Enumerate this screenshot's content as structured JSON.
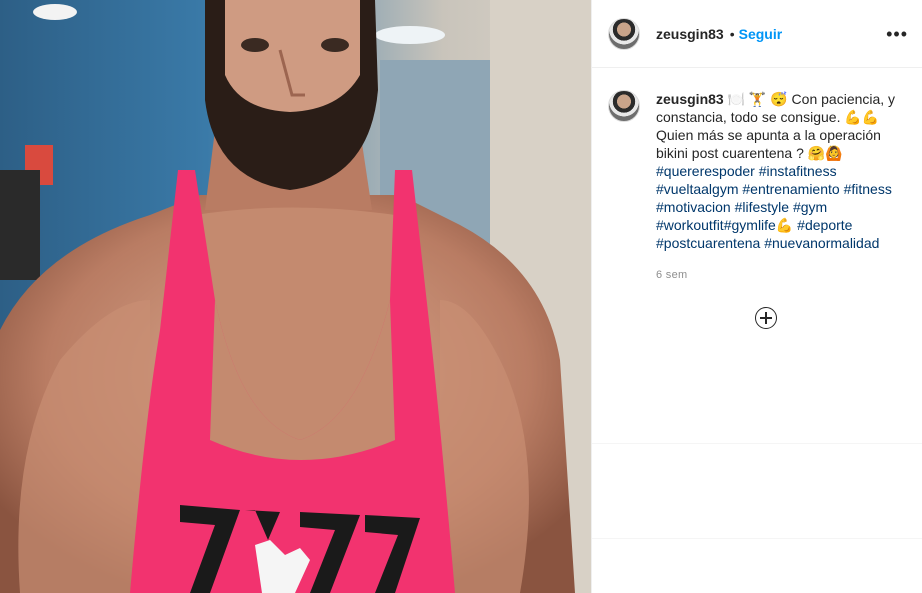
{
  "post": {
    "username": "zeusgin83",
    "follow_label": "Seguir",
    "dot": "•",
    "more_icon": "•••",
    "caption_line1": "🍽️ 🏋️ 😴 Con paciencia, y constancia, todo se consigue. 💪💪 Quien más se apunta a la operación bikini post cuarentena ? 🤗🙆",
    "hashtags": [
      "#quererespoder",
      "#instafitness",
      "#vueltaalgym",
      "#entrenamiento",
      "#fitness",
      "#motivacion",
      "#lifestyle",
      "#gym",
      "#workoutfit",
      "#gymlife",
      "💪",
      "#deporte",
      "#postcuarentena",
      "#nuevanormalidad"
    ],
    "time": "6 sem",
    "shirt_text": "ZYZZ"
  },
  "colors": {
    "accent": "#0095f6",
    "hashtag": "#00376b",
    "tank": "#f2336f"
  }
}
